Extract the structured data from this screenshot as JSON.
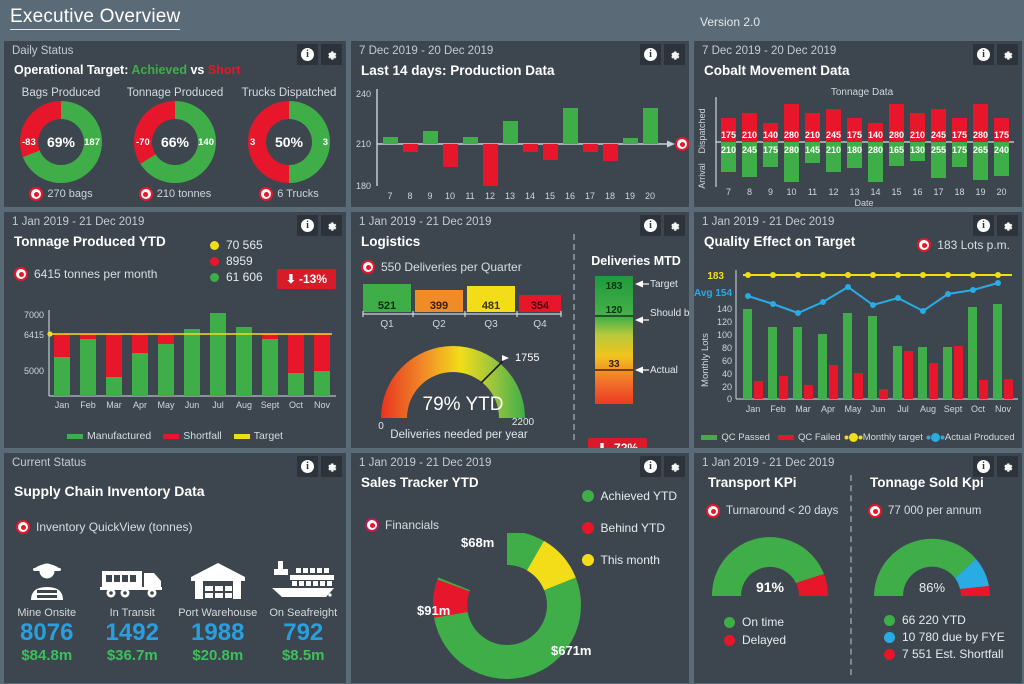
{
  "header": {
    "title": "Executive Overview",
    "version": "Version 2.0"
  },
  "icons": {
    "info": "i",
    "gear": "gear-icon"
  },
  "panels": {
    "daily_status": {
      "subtitle": "Daily Status",
      "title_prefix": "Operational Target:",
      "title_achieved": "Achieved",
      "title_vs": "vs",
      "title_short": "Short",
      "gauges": [
        {
          "label": "Bags Produced",
          "percent": "69%",
          "left": "-83",
          "right": "187",
          "footer": "270 bags",
          "value": 69
        },
        {
          "label": "Tonnage Produced",
          "percent": "66%",
          "left": "-70",
          "right": "140",
          "footer": "210 tonnes",
          "value": 66
        },
        {
          "label": "Trucks Dispatched",
          "percent": "50%",
          "left": "3",
          "right": "3",
          "footer": "6 Trucks",
          "value": 50
        }
      ]
    },
    "production": {
      "subtitle": "7 Dec 2019 - 20 Dec 2019",
      "title": "Last 14 days:  Production Data"
    },
    "cobalt": {
      "subtitle": "7 Dec 2019 - 20 Dec 2019",
      "title": "Cobalt Movement Data",
      "axis_top": "Dispatched",
      "axis_bottom": "Arrival",
      "series_label": "Tonnage Data",
      "xlabel": "Date"
    },
    "tonnage_ytd": {
      "subtitle": "1 Jan 2019 - 21 Dec 2019",
      "title": "Tonnage Produced YTD",
      "target_text": "6415 tonnes per month",
      "kpis": [
        {
          "color": "#f2dd18",
          "value": "70 565"
        },
        {
          "color": "#e8162a",
          "value": "8959"
        },
        {
          "color": "#3fae49",
          "value": "61 606"
        }
      ],
      "badge": "-13%"
    },
    "logistics": {
      "subtitle": "1 Jan 2019 - 21 Dec 2019",
      "title": "Logistics",
      "target_text": "550 Deliveries per Quarter",
      "quarters": [
        {
          "label": "Q1",
          "value": "521",
          "color": "#3fae49",
          "textcolor": "#0b2b10"
        },
        {
          "label": "Q2",
          "value": "399",
          "color": "#f08c28",
          "textcolor": "#3a1d00"
        },
        {
          "label": "Q3",
          "value": "481",
          "color": "#f2dd18",
          "textcolor": "#3a3300"
        },
        {
          "label": "Q4",
          "value": "354",
          "color": "#e8162a",
          "textcolor": "#4a0008"
        }
      ],
      "gauge": {
        "center": "79% YTD",
        "min": "0",
        "max": "2200",
        "needle_label": "1755",
        "caption": "Deliveries needed per year"
      },
      "mtd": {
        "title": "Deliveries MTD",
        "target_value": "183",
        "target_label": "Target",
        "should_value": "120",
        "should_label": "Should be",
        "actual_value": "33",
        "actual_label": "Actual",
        "badge": "-72%"
      }
    },
    "quality": {
      "subtitle": "1 Jan 2019 - 21 Dec 2019",
      "title": "Quality Effect on Target",
      "target_text": "183 Lots p.m.",
      "target_axis_label": "183",
      "avg_label": "Avg 154",
      "ylabel": "Monthly Lots"
    },
    "inventory": {
      "subtitle": "Current Status",
      "title": "Supply Chain Inventory Data",
      "target_text": "Inventory QuickView (tonnes)",
      "items": [
        {
          "icon": "miner-icon",
          "name": "Mine Onsite",
          "qty": "8076",
          "money": "$84.8m"
        },
        {
          "icon": "truck-icon",
          "name": "In Transit",
          "qty": "1492",
          "money": "$36.7m"
        },
        {
          "icon": "warehouse-icon",
          "name": "Port Warehouse",
          "qty": "1988",
          "money": "$20.8m"
        },
        {
          "icon": "ship-icon",
          "name": "On Seafreight",
          "qty": "792",
          "money": "$8.5m"
        }
      ]
    },
    "sales": {
      "subtitle": "1 Jan 2019 - 21 Dec 2019",
      "title": "Sales Tracker YTD",
      "source_label": "Financials",
      "legend": [
        {
          "color": "#3fae49",
          "label": "Achieved YTD"
        },
        {
          "color": "#e8162a",
          "label": "Behind  YTD"
        },
        {
          "color": "#f2dd18",
          "label": "This month"
        }
      ],
      "labels": {
        "yellow": "$68m",
        "red": "$91m",
        "green": "$671m"
      }
    },
    "transport_kpi": {
      "subtitle": "1 Jan 2019 - 21 Dec 2019",
      "title": "Transport KPi",
      "target_text": "Turnaround < 20 days",
      "gauge_value": "91%",
      "legend": [
        {
          "color": "#3fae49",
          "label": "On time"
        },
        {
          "color": "#e8162a",
          "label": "Delayed"
        }
      ]
    },
    "tonnage_kpi": {
      "title": "Tonnage Sold Kpi",
      "target_text": "77 000 per annum",
      "gauge_value": "86%",
      "legend": [
        {
          "color": "#3fae49",
          "label": "66 220 YTD"
        },
        {
          "color": "#29ace3",
          "label": "10 780  due by FYE"
        },
        {
          "color": "#e8162a",
          "label": "7 551 Est. Shortfall"
        }
      ]
    }
  },
  "chart_data": [
    {
      "id": "production_data",
      "type": "bar",
      "title": "Last 14 days:  Production Data",
      "categories": [
        "7",
        "8",
        "9",
        "10",
        "11",
        "12",
        "13",
        "14",
        "15",
        "16",
        "17",
        "18",
        "19",
        "20"
      ],
      "values": [
        214,
        206,
        217,
        197,
        214,
        181,
        224,
        206,
        202,
        232,
        206,
        201,
        205,
        232
      ],
      "baseline": 210,
      "ylim": [
        180,
        240
      ],
      "yticks": [
        180,
        210,
        240
      ],
      "xlabel": "",
      "ylabel": "",
      "colors": {
        "above": "#3fae49",
        "below": "#e8162a"
      }
    },
    {
      "id": "cobalt_movement",
      "type": "bar",
      "title": "Cobalt Movement Data",
      "subtitle": "Tonnage Data",
      "categories": [
        "7",
        "8",
        "9",
        "10",
        "11",
        "12",
        "13",
        "14",
        "15",
        "16",
        "17",
        "18",
        "19",
        "20"
      ],
      "series": [
        {
          "name": "Dispatched",
          "values": [
            175,
            210,
            140,
            280,
            210,
            245,
            175,
            140,
            280,
            210,
            245,
            175,
            280,
            175
          ],
          "color": "#e8162a"
        },
        {
          "name": "Arrival",
          "values": [
            210,
            245,
            175,
            280,
            145,
            210,
            180,
            280,
            165,
            130,
            255,
            175,
            265,
            240
          ],
          "color": "#3fae49"
        }
      ],
      "xlabel": "Date",
      "ylabel": ""
    },
    {
      "id": "tonnage_produced_ytd",
      "type": "bar",
      "title": "Tonnage Produced YTD",
      "categories": [
        "Jan",
        "Feb",
        "Mar",
        "Apr",
        "May",
        "Jun",
        "Jul",
        "Aug",
        "Sept",
        "Oct",
        "Nov"
      ],
      "series": [
        {
          "name": "Manufactured",
          "values": [
            5500,
            6200,
            4850,
            5650,
            6050,
            6650,
            7000,
            6700,
            6200,
            5020,
            5150
          ],
          "color": "#3fae49"
        },
        {
          "name": "Shortfall",
          "values": [
            915,
            215,
            1565,
            765,
            365,
            0,
            0,
            0,
            215,
            1395,
            1265
          ],
          "color": "#e8162a"
        },
        {
          "name": "Target",
          "values": [
            6415
          ],
          "color": "#f2dd18"
        }
      ],
      "target": 6415,
      "ylim": [
        3500,
        7300
      ],
      "yticks": [
        5000,
        6415,
        7000
      ],
      "legend": [
        "Manufactured",
        "Shortfall",
        "Target"
      ],
      "xlabel": "",
      "ylabel": ""
    },
    {
      "id": "logistics_quarters",
      "type": "bar",
      "title": "Logistics",
      "categories": [
        "Q1",
        "Q2",
        "Q3",
        "Q4"
      ],
      "values": [
        521,
        399,
        481,
        354
      ],
      "target": 550
    },
    {
      "id": "logistics_gauge",
      "type": "gauge",
      "title": "Deliveries needed per year",
      "min": 0,
      "max": 2200,
      "value": 1755,
      "percent": 79
    },
    {
      "id": "deliveries_mtd",
      "type": "bar",
      "title": "Deliveries MTD",
      "target": 183,
      "should_be": 120,
      "actual": 33,
      "variance_pct": -72
    },
    {
      "id": "quality_effect",
      "type": "bar",
      "title": "Quality Effect on Target",
      "categories": [
        "Jan",
        "Feb",
        "Mar",
        "Apr",
        "May",
        "Jun",
        "Jul",
        "Aug",
        "Sept",
        "Oct",
        "Nov"
      ],
      "series": [
        {
          "name": "QC Passed",
          "values": [
            138,
            110,
            110,
            99,
            132,
            128,
            81,
            80,
            80,
            141,
            146
          ],
          "color": "#3fae49"
        },
        {
          "name": "QC Failed",
          "values": [
            28,
            36,
            22,
            52,
            40,
            16,
            74,
            55,
            81,
            29,
            31
          ],
          "color": "#e8162a"
        },
        {
          "name": "Monthly target",
          "values": [
            183,
            183,
            183,
            183,
            183,
            183,
            183,
            183,
            183,
            183,
            183
          ],
          "color": "#f2dd18"
        },
        {
          "name": "Actual Produced",
          "values": [
            156,
            145,
            131,
            150,
            169,
            143,
            155,
            134,
            159,
            166,
            175
          ],
          "color": "#29ace3"
        }
      ],
      "ylim": [
        0,
        183
      ],
      "yticks": [
        0,
        20,
        40,
        60,
        80,
        100,
        120,
        140,
        183
      ],
      "avg": 154,
      "ylabel": "Monthly Lots",
      "legend": [
        "QC Passed",
        "QC Failed",
        "Monthly target",
        "Actual Produced"
      ]
    },
    {
      "id": "sales_tracker",
      "type": "pie",
      "title": "Sales Tracker YTD",
      "labels": [
        "Achieved YTD",
        "Behind  YTD",
        "This month"
      ],
      "values": [
        671,
        91,
        68
      ],
      "display_values": [
        "$671m",
        "$91m",
        "$68m"
      ],
      "colors": [
        "#3fae49",
        "#e8162a",
        "#f2dd18"
      ]
    },
    {
      "id": "transport_kpi_gauge",
      "type": "pie",
      "title": "Transport KPi",
      "labels": [
        "On time",
        "Delayed"
      ],
      "values": [
        91,
        9
      ],
      "colors": [
        "#3fae49",
        "#e8162a"
      ],
      "center": "91%"
    },
    {
      "id": "tonnage_sold_gauge",
      "type": "pie",
      "title": "Tonnage Sold Kpi",
      "labels": [
        "66 220 YTD",
        "10 780  due by FYE",
        "7 551 Est. Shortfall"
      ],
      "values": [
        66220,
        10780,
        7551
      ],
      "colors": [
        "#3fae49",
        "#29ace3",
        "#e8162a"
      ],
      "center": "86%"
    }
  ]
}
